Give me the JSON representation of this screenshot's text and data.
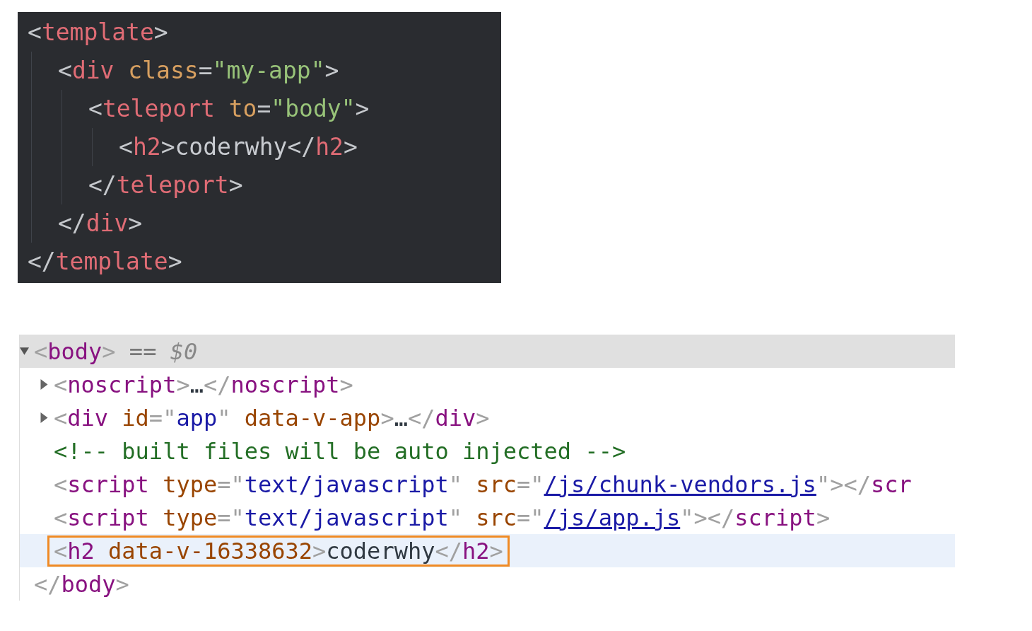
{
  "code_editor": {
    "nodes": [
      {
        "open": [
          {
            "kind": "punct",
            "text": "<"
          },
          {
            "kind": "tag",
            "text": "template"
          },
          {
            "kind": "punct",
            "text": ">"
          }
        ],
        "close": [
          {
            "kind": "punct",
            "text": "</"
          },
          {
            "kind": "tag",
            "text": "template"
          },
          {
            "kind": "punct",
            "text": ">"
          }
        ],
        "children": [
          {
            "open": [
              {
                "kind": "punct",
                "text": "<"
              },
              {
                "kind": "tag",
                "text": "div"
              },
              {
                "kind": "attr",
                "text": " class"
              },
              {
                "kind": "punct",
                "text": "="
              },
              {
                "kind": "string",
                "text": "\"my-app\""
              },
              {
                "kind": "punct",
                "text": ">"
              }
            ],
            "close": [
              {
                "kind": "punct",
                "text": "</"
              },
              {
                "kind": "tag",
                "text": "div"
              },
              {
                "kind": "punct",
                "text": ">"
              }
            ],
            "children": [
              {
                "open": [
                  {
                    "kind": "punct",
                    "text": "<"
                  },
                  {
                    "kind": "tag",
                    "text": "teleport"
                  },
                  {
                    "kind": "attr",
                    "text": " to"
                  },
                  {
                    "kind": "punct",
                    "text": "="
                  },
                  {
                    "kind": "string",
                    "text": "\"body\""
                  },
                  {
                    "kind": "punct",
                    "text": ">"
                  }
                ],
                "close": [
                  {
                    "kind": "punct",
                    "text": "</"
                  },
                  {
                    "kind": "tag",
                    "text": "teleport"
                  },
                  {
                    "kind": "punct",
                    "text": ">"
                  }
                ],
                "children": [
                  {
                    "open": [
                      {
                        "kind": "punct",
                        "text": "<"
                      },
                      {
                        "kind": "tag",
                        "text": "h2"
                      },
                      {
                        "kind": "punct",
                        "text": ">"
                      },
                      {
                        "kind": "text",
                        "text": "coderwhy"
                      },
                      {
                        "kind": "punct",
                        "text": "</"
                      },
                      {
                        "kind": "tag",
                        "text": "h2"
                      },
                      {
                        "kind": "punct",
                        "text": ">"
                      }
                    ]
                  }
                ]
              }
            ]
          }
        ]
      }
    ]
  },
  "elements_panel": {
    "rows": [
      {
        "expanded": true,
        "selected": true,
        "hovered": false,
        "outlined": false,
        "tokens": [
          {
            "kind": "punct",
            "text": "<"
          },
          {
            "kind": "tag",
            "text": "body"
          },
          {
            "kind": "punct",
            "text": ">"
          },
          {
            "kind": "console",
            "text": " == "
          },
          {
            "kind": "console_var",
            "text": "$0"
          }
        ],
        "close": [
          {
            "kind": "punct",
            "text": "</"
          },
          {
            "kind": "tag",
            "text": "body"
          },
          {
            "kind": "punct",
            "text": ">"
          }
        ],
        "children": [
          {
            "expanded": false,
            "selected": false,
            "hovered": false,
            "outlined": false,
            "tokens": [
              {
                "kind": "punct",
                "text": "<"
              },
              {
                "kind": "tag",
                "text": "noscript"
              },
              {
                "kind": "punct",
                "text": ">"
              },
              {
                "kind": "text",
                "text": "…"
              },
              {
                "kind": "punct",
                "text": "</"
              },
              {
                "kind": "tag",
                "text": "noscript"
              },
              {
                "kind": "punct",
                "text": ">"
              }
            ]
          },
          {
            "expanded": false,
            "selected": false,
            "hovered": false,
            "outlined": false,
            "tokens": [
              {
                "kind": "punct",
                "text": "<"
              },
              {
                "kind": "tag",
                "text": "div"
              },
              {
                "kind": "attr",
                "text": " id"
              },
              {
                "kind": "punct",
                "text": "=\""
              },
              {
                "kind": "value",
                "text": "app"
              },
              {
                "kind": "punct",
                "text": "\" "
              },
              {
                "kind": "attr",
                "text": "data-v-app"
              },
              {
                "kind": "punct",
                "text": ">"
              },
              {
                "kind": "text",
                "text": "…"
              },
              {
                "kind": "punct",
                "text": "</"
              },
              {
                "kind": "tag",
                "text": "div"
              },
              {
                "kind": "punct",
                "text": ">"
              }
            ]
          },
          {
            "selected": false,
            "hovered": false,
            "outlined": false,
            "tokens": [
              {
                "kind": "comment",
                "text": "<!-- built files will be auto injected -->"
              }
            ]
          },
          {
            "selected": false,
            "hovered": false,
            "outlined": false,
            "tokens": [
              {
                "kind": "punct",
                "text": "<"
              },
              {
                "kind": "tag",
                "text": "script"
              },
              {
                "kind": "attr",
                "text": " type"
              },
              {
                "kind": "punct",
                "text": "=\""
              },
              {
                "kind": "value",
                "text": "text/javascript"
              },
              {
                "kind": "punct",
                "text": "\" "
              },
              {
                "kind": "attr",
                "text": "src"
              },
              {
                "kind": "punct",
                "text": "=\""
              },
              {
                "kind": "link",
                "text": "/js/chunk-vendors.js"
              },
              {
                "kind": "punct",
                "text": "\"></"
              },
              {
                "kind": "tag",
                "text": "scr"
              }
            ]
          },
          {
            "selected": false,
            "hovered": false,
            "outlined": false,
            "tokens": [
              {
                "kind": "punct",
                "text": "<"
              },
              {
                "kind": "tag",
                "text": "script"
              },
              {
                "kind": "attr",
                "text": " type"
              },
              {
                "kind": "punct",
                "text": "=\""
              },
              {
                "kind": "value",
                "text": "text/javascript"
              },
              {
                "kind": "punct",
                "text": "\" "
              },
              {
                "kind": "attr",
                "text": "src"
              },
              {
                "kind": "punct",
                "text": "=\""
              },
              {
                "kind": "link",
                "text": "/js/app.js"
              },
              {
                "kind": "punct",
                "text": "\"></"
              },
              {
                "kind": "tag",
                "text": "script"
              },
              {
                "kind": "punct",
                "text": ">"
              }
            ]
          },
          {
            "selected": false,
            "hovered": true,
            "outlined": true,
            "tokens": [
              {
                "kind": "punct",
                "text": "<"
              },
              {
                "kind": "tag",
                "text": "h2"
              },
              {
                "kind": "attr",
                "text": " data-v-16338632"
              },
              {
                "kind": "punct",
                "text": ">"
              },
              {
                "kind": "text",
                "text": "coderwhy"
              },
              {
                "kind": "punct",
                "text": "</"
              },
              {
                "kind": "tag",
                "text": "h2"
              },
              {
                "kind": "punct",
                "text": ">"
              }
            ]
          }
        ]
      }
    ]
  }
}
